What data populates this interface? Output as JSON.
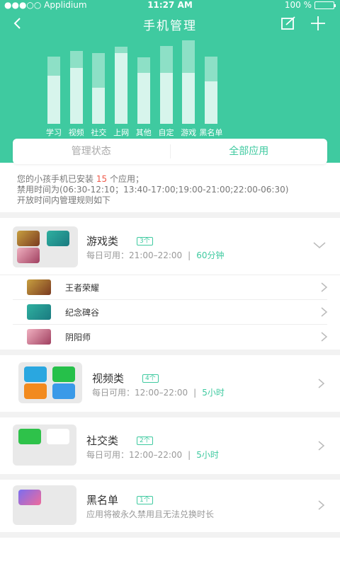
{
  "status_bar": {
    "carrier": "●●●○○ Applidium",
    "time": "11:27 AM",
    "battery": "100 %"
  },
  "nav": {
    "title": "手机管理"
  },
  "chart_data": {
    "type": "bar",
    "categories": [
      "学习",
      "视频",
      "社交",
      "上网",
      "其他",
      "自定",
      "游戏",
      "黑名单"
    ],
    "series": [
      {
        "values": [
          62,
          72,
          47,
          92,
          66,
          66,
          66,
          55
        ]
      },
      {
        "values": [
          25,
          22,
          45,
          8,
          20,
          35,
          42,
          32
        ]
      }
    ],
    "ylim": [
      0,
      110
    ],
    "colors": {
      "lower": "#d7f5ec",
      "upper": "#8de0c6"
    }
  },
  "tabs": [
    "管理状态",
    "全部应用"
  ],
  "summary": {
    "line1_prefix": "您的小孩手机已安装",
    "line1_count": "15",
    "line1_suffix": "个应用；",
    "line2": "禁用时间为(06:30-12:10；13:40-17:00;19:00-21:00;22:00-06:30)",
    "line3": "开放时间内管理规则如下"
  },
  "categories": [
    {
      "name": "游戏类",
      "count": "3个",
      "time": "每日可用：21:00–22:00",
      "limit": "60分钟",
      "apps": [
        "王者荣耀",
        "纪念碑谷",
        "阴阳师"
      ]
    },
    {
      "name": "视频类",
      "count": "4个",
      "time": "每日可用：12:00–22:00",
      "limit": "5小时"
    },
    {
      "name": "社交类",
      "count": "2个",
      "time": "每日可用：12:00–22:00",
      "limit": "5小时"
    },
    {
      "name": "黑名单",
      "count": "1个",
      "desc": "应用将被永久禁用且无法兑换时长"
    }
  ],
  "colors": {
    "accent": "#3fcaa0",
    "highlight": "#f05a4a"
  }
}
